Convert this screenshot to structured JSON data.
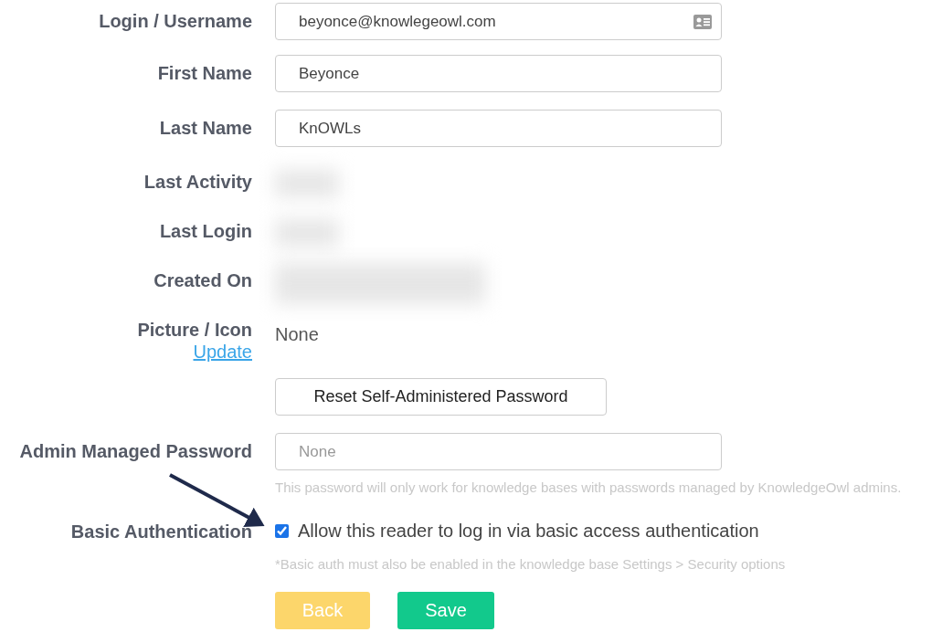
{
  "rows": [
    {
      "kind": "input",
      "label": "Login / Username",
      "value": "beyonce@knowlegeowl.com"
    },
    {
      "kind": "input",
      "label": "First Name",
      "value": "Beyonce"
    },
    {
      "kind": "input",
      "label": "Last Name",
      "value": "KnOWLs"
    },
    {
      "kind": "redacted",
      "label": "Last Activity"
    },
    {
      "kind": "redacted",
      "label": "Last Login"
    },
    {
      "kind": "redacted",
      "label": "Created On"
    },
    {
      "kind": "picture",
      "label": "Picture / Icon",
      "link": "Update",
      "value": "None"
    },
    {
      "kind": "button",
      "text": "Reset Self-Administered Password"
    },
    {
      "kind": "password",
      "label": "Admin Managed Password",
      "placeholder": "None",
      "hint": "This password will only work for knowledge bases with passwords managed by KnowledgeOwl admins."
    },
    {
      "kind": "checkbox",
      "label": "Basic Authentication",
      "text": "Allow this reader to log in via basic access authentication",
      "checked": true,
      "hint": "*Basic auth must also be enabled in the knowledge base Settings > Security options"
    }
  ],
  "actions": [
    {
      "kind": "back",
      "text": "Back"
    },
    {
      "kind": "save",
      "text": "Save"
    }
  ]
}
